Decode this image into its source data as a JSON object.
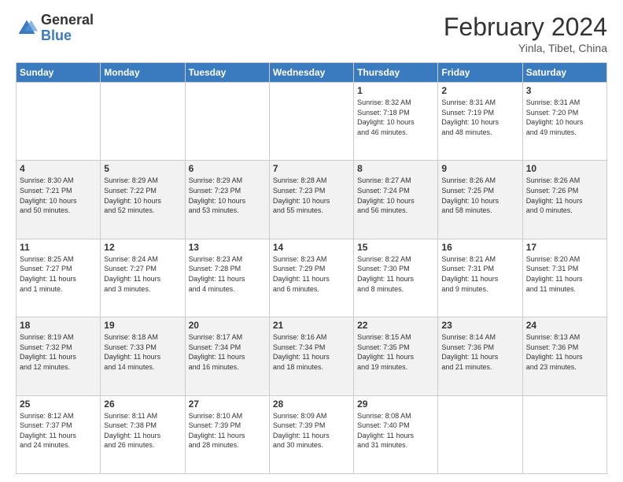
{
  "logo": {
    "general": "General",
    "blue": "Blue"
  },
  "title": {
    "month_year": "February 2024",
    "location": "Yinla, Tibet, China"
  },
  "weekdays": [
    "Sunday",
    "Monday",
    "Tuesday",
    "Wednesday",
    "Thursday",
    "Friday",
    "Saturday"
  ],
  "weeks": [
    [
      {
        "day": "",
        "info": ""
      },
      {
        "day": "",
        "info": ""
      },
      {
        "day": "",
        "info": ""
      },
      {
        "day": "",
        "info": ""
      },
      {
        "day": "1",
        "info": "Sunrise: 8:32 AM\nSunset: 7:18 PM\nDaylight: 10 hours\nand 46 minutes."
      },
      {
        "day": "2",
        "info": "Sunrise: 8:31 AM\nSunset: 7:19 PM\nDaylight: 10 hours\nand 48 minutes."
      },
      {
        "day": "3",
        "info": "Sunrise: 8:31 AM\nSunset: 7:20 PM\nDaylight: 10 hours\nand 49 minutes."
      }
    ],
    [
      {
        "day": "4",
        "info": "Sunrise: 8:30 AM\nSunset: 7:21 PM\nDaylight: 10 hours\nand 50 minutes."
      },
      {
        "day": "5",
        "info": "Sunrise: 8:29 AM\nSunset: 7:22 PM\nDaylight: 10 hours\nand 52 minutes."
      },
      {
        "day": "6",
        "info": "Sunrise: 8:29 AM\nSunset: 7:23 PM\nDaylight: 10 hours\nand 53 minutes."
      },
      {
        "day": "7",
        "info": "Sunrise: 8:28 AM\nSunset: 7:23 PM\nDaylight: 10 hours\nand 55 minutes."
      },
      {
        "day": "8",
        "info": "Sunrise: 8:27 AM\nSunset: 7:24 PM\nDaylight: 10 hours\nand 56 minutes."
      },
      {
        "day": "9",
        "info": "Sunrise: 8:26 AM\nSunset: 7:25 PM\nDaylight: 10 hours\nand 58 minutes."
      },
      {
        "day": "10",
        "info": "Sunrise: 8:26 AM\nSunset: 7:26 PM\nDaylight: 11 hours\nand 0 minutes."
      }
    ],
    [
      {
        "day": "11",
        "info": "Sunrise: 8:25 AM\nSunset: 7:27 PM\nDaylight: 11 hours\nand 1 minute."
      },
      {
        "day": "12",
        "info": "Sunrise: 8:24 AM\nSunset: 7:27 PM\nDaylight: 11 hours\nand 3 minutes."
      },
      {
        "day": "13",
        "info": "Sunrise: 8:23 AM\nSunset: 7:28 PM\nDaylight: 11 hours\nand 4 minutes."
      },
      {
        "day": "14",
        "info": "Sunrise: 8:23 AM\nSunset: 7:29 PM\nDaylight: 11 hours\nand 6 minutes."
      },
      {
        "day": "15",
        "info": "Sunrise: 8:22 AM\nSunset: 7:30 PM\nDaylight: 11 hours\nand 8 minutes."
      },
      {
        "day": "16",
        "info": "Sunrise: 8:21 AM\nSunset: 7:31 PM\nDaylight: 11 hours\nand 9 minutes."
      },
      {
        "day": "17",
        "info": "Sunrise: 8:20 AM\nSunset: 7:31 PM\nDaylight: 11 hours\nand 11 minutes."
      }
    ],
    [
      {
        "day": "18",
        "info": "Sunrise: 8:19 AM\nSunset: 7:32 PM\nDaylight: 11 hours\nand 12 minutes."
      },
      {
        "day": "19",
        "info": "Sunrise: 8:18 AM\nSunset: 7:33 PM\nDaylight: 11 hours\nand 14 minutes."
      },
      {
        "day": "20",
        "info": "Sunrise: 8:17 AM\nSunset: 7:34 PM\nDaylight: 11 hours\nand 16 minutes."
      },
      {
        "day": "21",
        "info": "Sunrise: 8:16 AM\nSunset: 7:34 PM\nDaylight: 11 hours\nand 18 minutes."
      },
      {
        "day": "22",
        "info": "Sunrise: 8:15 AM\nSunset: 7:35 PM\nDaylight: 11 hours\nand 19 minutes."
      },
      {
        "day": "23",
        "info": "Sunrise: 8:14 AM\nSunset: 7:36 PM\nDaylight: 11 hours\nand 21 minutes."
      },
      {
        "day": "24",
        "info": "Sunrise: 8:13 AM\nSunset: 7:36 PM\nDaylight: 11 hours\nand 23 minutes."
      }
    ],
    [
      {
        "day": "25",
        "info": "Sunrise: 8:12 AM\nSunset: 7:37 PM\nDaylight: 11 hours\nand 24 minutes."
      },
      {
        "day": "26",
        "info": "Sunrise: 8:11 AM\nSunset: 7:38 PM\nDaylight: 11 hours\nand 26 minutes."
      },
      {
        "day": "27",
        "info": "Sunrise: 8:10 AM\nSunset: 7:39 PM\nDaylight: 11 hours\nand 28 minutes."
      },
      {
        "day": "28",
        "info": "Sunrise: 8:09 AM\nSunset: 7:39 PM\nDaylight: 11 hours\nand 30 minutes."
      },
      {
        "day": "29",
        "info": "Sunrise: 8:08 AM\nSunset: 7:40 PM\nDaylight: 11 hours\nand 31 minutes."
      },
      {
        "day": "",
        "info": ""
      },
      {
        "day": "",
        "info": ""
      }
    ]
  ]
}
